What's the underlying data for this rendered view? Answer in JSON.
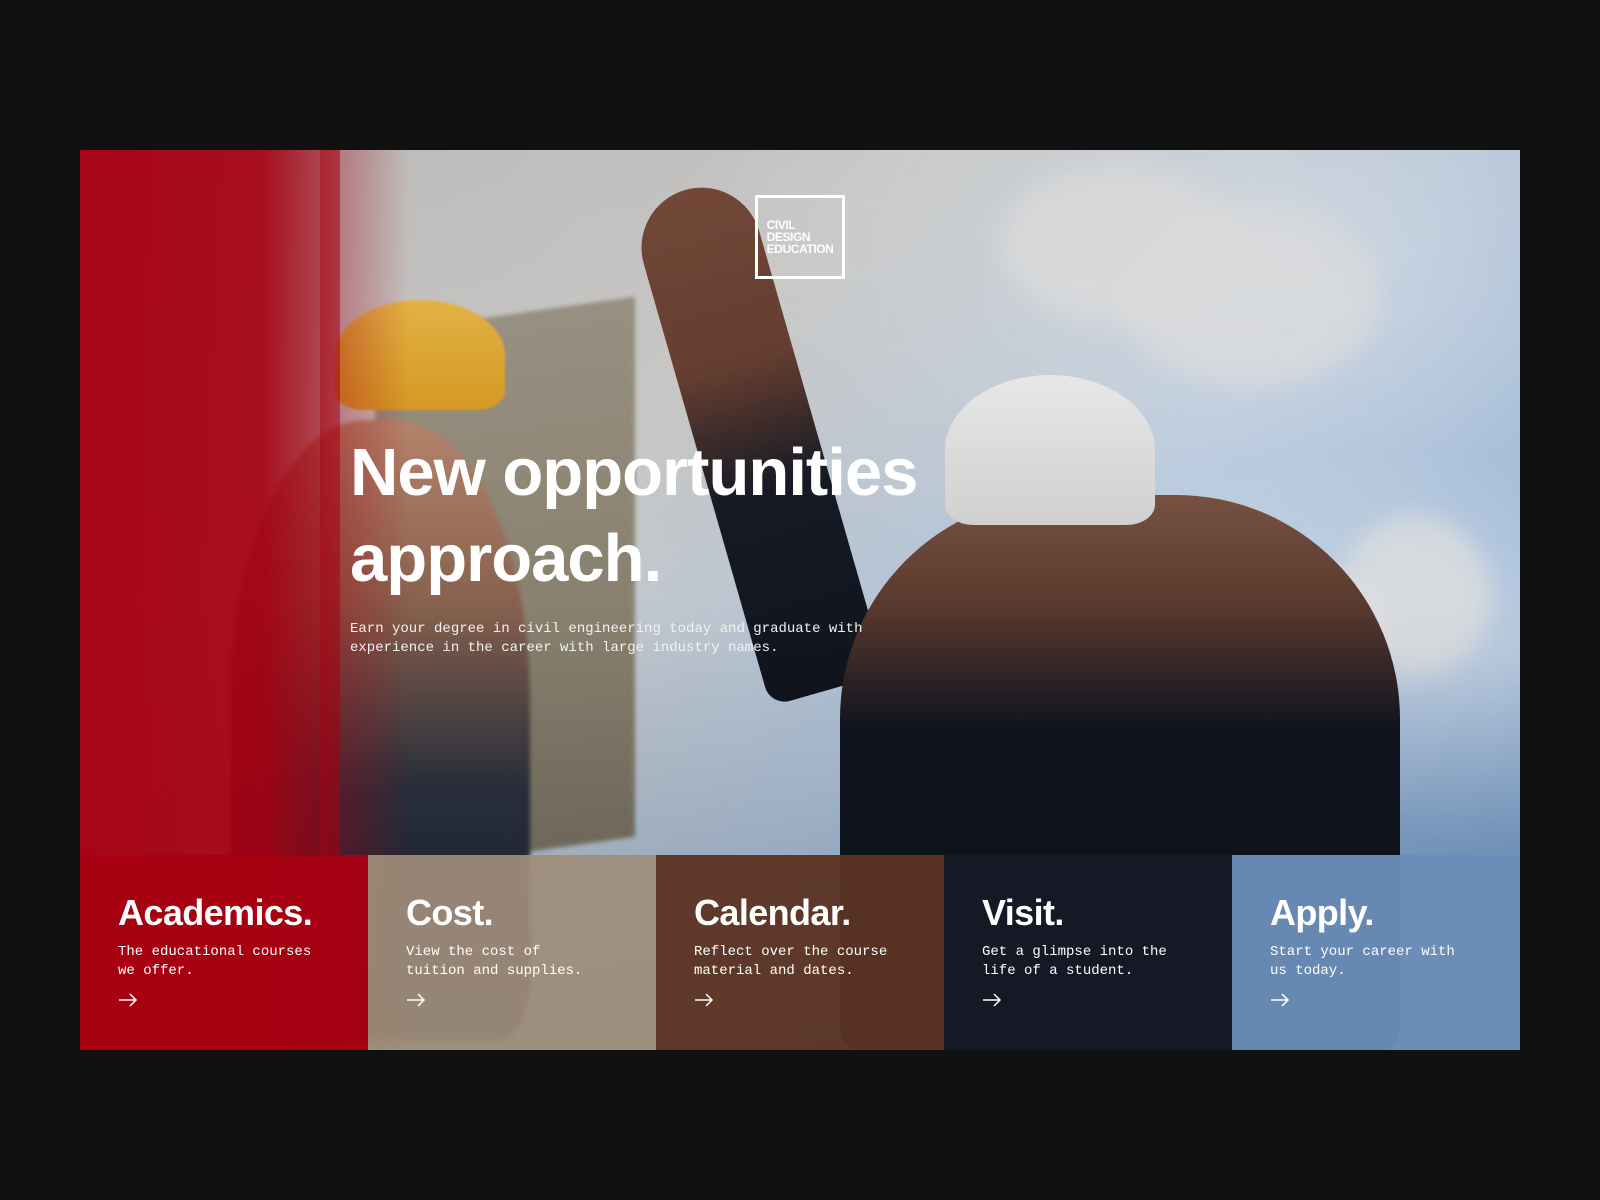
{
  "brand": {
    "logo_lines": [
      "CIVIL",
      "DESIGN",
      "EDUCATION"
    ]
  },
  "hero": {
    "headline_lines": [
      "New opportunities",
      "approach."
    ],
    "subtext": "Earn your degree in civil engineering today and graduate with experience in the career with large industry names."
  },
  "tiles": [
    {
      "title": "Academics.",
      "description": "The educational courses we offer.",
      "icon": "arrow-right-icon",
      "color": "#a60012"
    },
    {
      "title": "Cost.",
      "description": "View the cost of tuition and supplies.",
      "icon": "arrow-right-icon",
      "color": "#9f8d7a"
    },
    {
      "title": "Calendar.",
      "description": "Reflect over the course material and dates.",
      "icon": "arrow-right-icon",
      "color": "#5c3423"
    },
    {
      "title": "Visit.",
      "description": "Get a glimpse into the life of a student.",
      "icon": "arrow-right-icon",
      "color": "#151826"
    },
    {
      "title": "Apply.",
      "description": "Start your career with us today.",
      "icon": "arrow-right-icon",
      "color": "#6b8eb8"
    }
  ],
  "colors": {
    "page_background": "#111111",
    "brand_red": "#a60012",
    "text": "#ffffff"
  }
}
